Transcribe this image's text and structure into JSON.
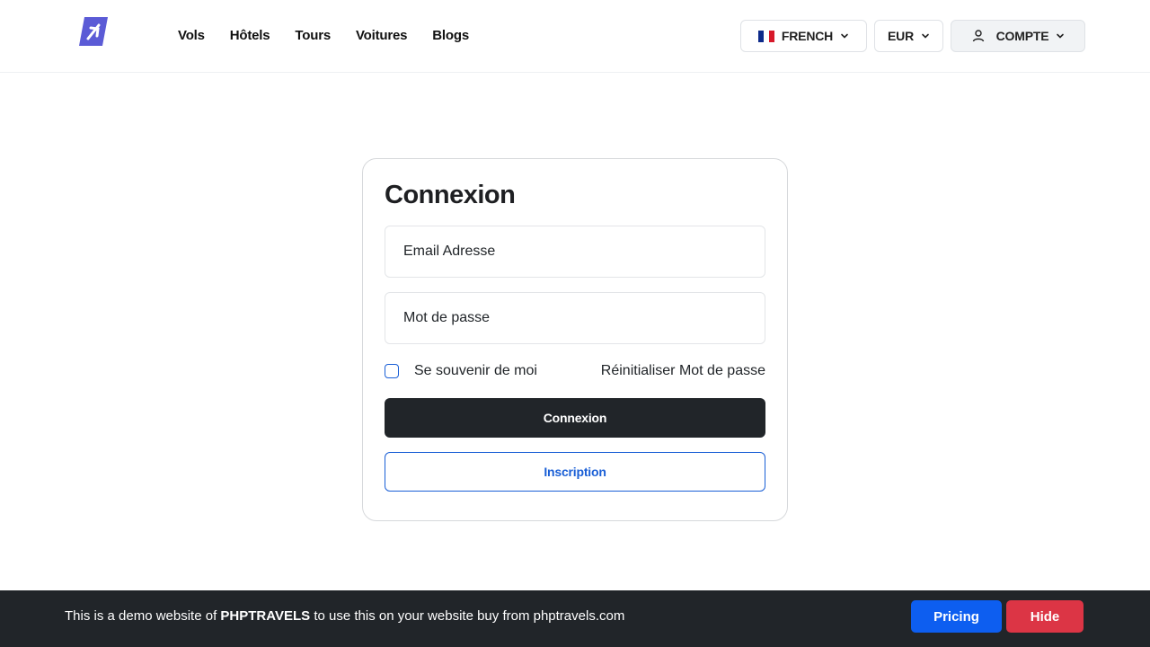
{
  "colors": {
    "accent_dark": "#212529",
    "link_blue": "#1a5fd6",
    "pricing_blue": "#0d5ef0",
    "hide_red": "#dc3545",
    "logo_purple": "#5b5bd6"
  },
  "header": {
    "logo_icon": "plane-logo-icon",
    "nav": {
      "flights": "Vols",
      "hotels": "Hôtels",
      "tours": "Tours",
      "cars": "Voitures",
      "blogs": "Blogs"
    },
    "language": {
      "label": "FRENCH",
      "flag": "france-flag-icon"
    },
    "currency": {
      "label": "EUR"
    },
    "account": {
      "label": "COMPTE",
      "icon": "user-icon"
    }
  },
  "login": {
    "title": "Connexion",
    "email_placeholder": "Email Adresse",
    "password_placeholder": "Mot de passe",
    "remember_label": "Se souvenir de moi",
    "remember_checked": false,
    "reset_label": "Réinitialiser Mot de passe",
    "login_button": "Connexion",
    "signup_button": "Inscription"
  },
  "banner": {
    "text_before": "This is a demo website of ",
    "brand": "PHPTRAVELS",
    "text_after": " to use this on your website buy from phptravels.com",
    "pricing_button": "Pricing",
    "hide_button": "Hide"
  }
}
